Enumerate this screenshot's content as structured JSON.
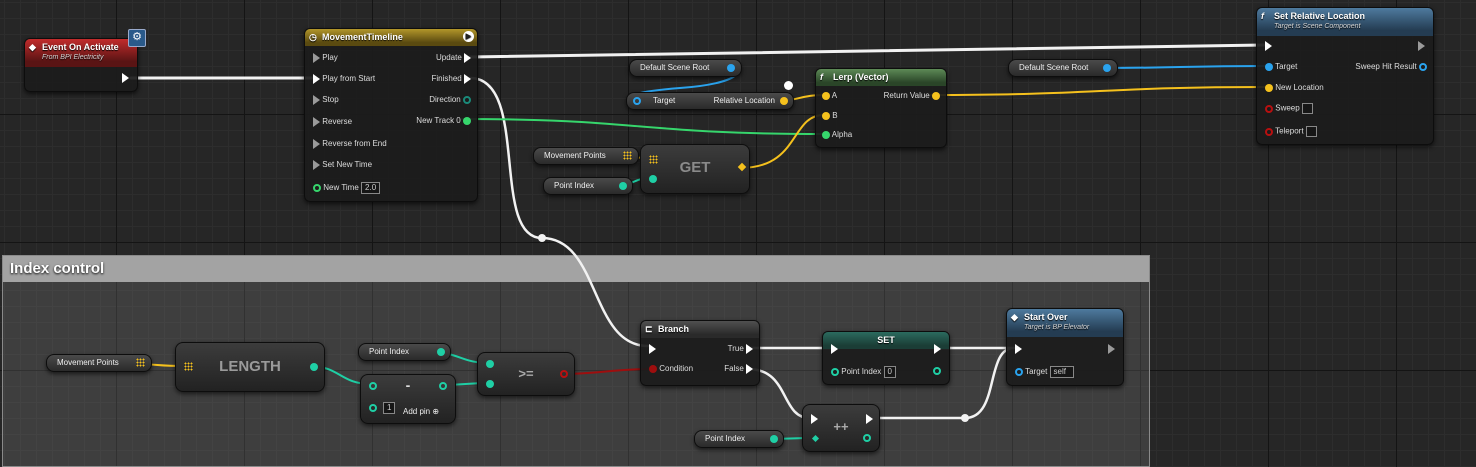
{
  "comment": {
    "title": "Index control"
  },
  "colors": {
    "exec": "#ffffff",
    "vector": "#f5c11d",
    "float": "#36d66c",
    "int": "#1fcfa5",
    "object": "#2aa3ee",
    "bool": "#9e0e0e",
    "event_header": "#c22c2c",
    "timeline_header": "#b2962a",
    "function_header": "#4e7a9e",
    "pure_header": "#5d8a56"
  },
  "event_on_activate": {
    "title": "Event On Activate",
    "subtitle": "From BPI Electricity",
    "icon": "event-diamond-icon"
  },
  "timeline": {
    "title": "MovementTimeline",
    "icon": "clock-icon",
    "inputs": [
      "Play",
      "Play from Start",
      "Stop",
      "Reverse",
      "Reverse from End",
      "Set New Time"
    ],
    "new_time_label": "New Time",
    "new_time_value": "2.0",
    "outputs": [
      "Update",
      "Finished",
      "Direction",
      "New Track 0"
    ]
  },
  "default_scene_root_1": "Default Scene Root",
  "get_relative_location": {
    "target_label": "Target",
    "output_label": "Relative Location"
  },
  "lerp": {
    "title": "Lerp (Vector)",
    "icon": "function-icon",
    "a": "A",
    "b": "B",
    "alpha": "Alpha",
    "return": "Return Value"
  },
  "default_scene_root_2": "Default Scene Root",
  "set_relative_location": {
    "title": "Set Relative Location",
    "subtitle": "Target is Scene Component",
    "icon": "function-icon",
    "target": "Target",
    "new_location": "New Location",
    "sweep": "Sweep",
    "teleport": "Teleport",
    "sweep_hit_result": "Sweep Hit Result"
  },
  "movement_points_1": "Movement Points",
  "point_index_1": "Point Index",
  "get_node": {
    "label": "GET"
  },
  "movement_points_2": "Movement Points",
  "length_node": {
    "label": "LENGTH"
  },
  "point_index_2": "Point Index",
  "subtract_node": {
    "label": "-",
    "value": "1",
    "add_pin": "Add pin"
  },
  "compare_node": {
    "label": ">="
  },
  "branch": {
    "title": "Branch",
    "icon": "branch-icon",
    "condition": "Condition",
    "true_label": "True",
    "false_label": "False"
  },
  "set_node": {
    "title": "SET",
    "point_index": "Point Index",
    "value": "0"
  },
  "increment_node": {
    "label": "++"
  },
  "point_index_3": "Point Index",
  "start_over": {
    "title": "Start Over",
    "subtitle": "Target is BP Elevator",
    "icon": "function-icon",
    "target": "Target",
    "target_value": "self"
  }
}
